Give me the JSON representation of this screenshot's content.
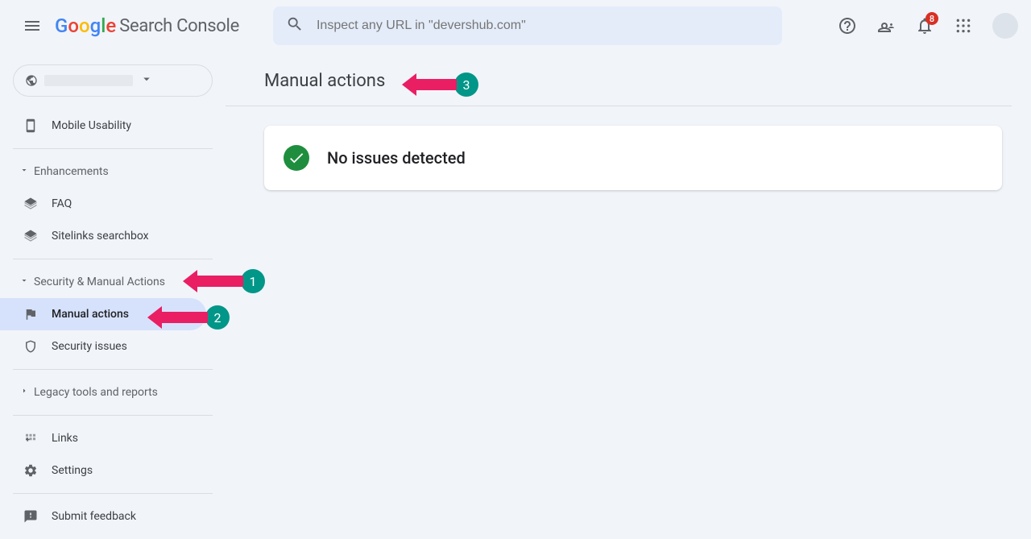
{
  "header": {
    "logo_label": "Search Console",
    "search_placeholder": "Inspect any URL in \"devershub.com\"",
    "notification_count": "8"
  },
  "sidebar": {
    "mobile_usability": "Mobile Usability",
    "groups": {
      "enhancements": "Enhancements",
      "security": "Security & Manual Actions",
      "legacy": "Legacy tools and reports"
    },
    "items": {
      "faq": "FAQ",
      "sitelinks": "Sitelinks searchbox",
      "manual_actions": "Manual actions",
      "security_issues": "Security issues",
      "links": "Links",
      "settings": "Settings",
      "submit_feedback": "Submit feedback"
    }
  },
  "main": {
    "title": "Manual actions",
    "status_text": "No issues detected"
  },
  "annotations": {
    "a1": "1",
    "a2": "2",
    "a3": "3"
  }
}
